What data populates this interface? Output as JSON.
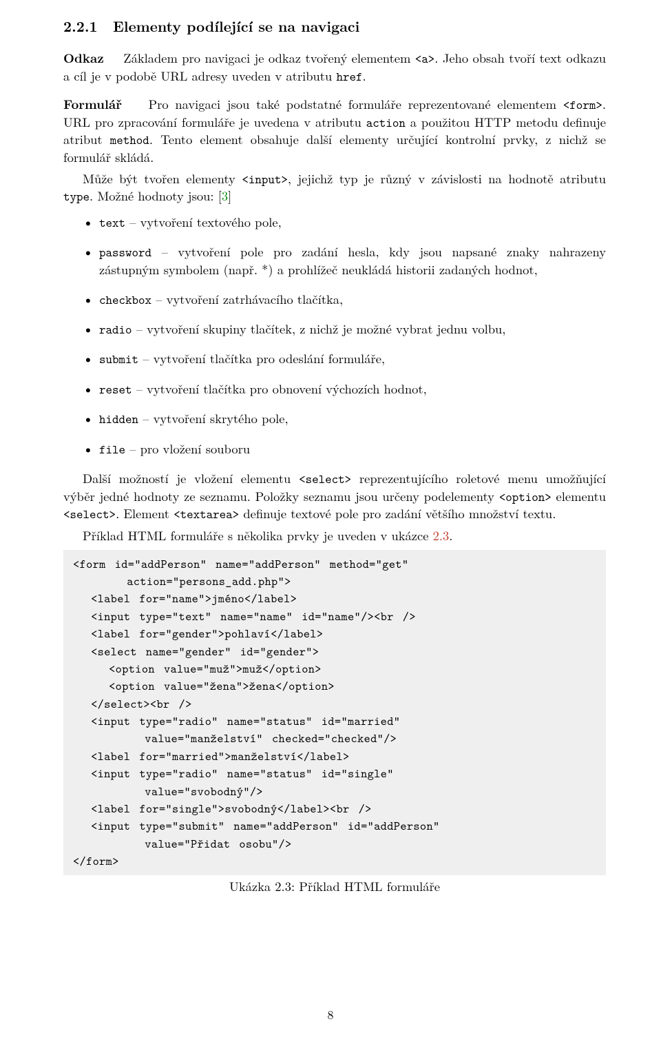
{
  "section": {
    "number": "2.2.1",
    "title": "Elementy podílející se na navigaci"
  },
  "odkaz": {
    "runin": "Odkaz",
    "text_a": "Základem pro navigaci je odkaz tvořený elementem ",
    "code_a": "<a>",
    "text_b": ". Jeho obsah tvoří text odkazu a cíl je v podobě URL adresy uveden v atributu ",
    "code_href": "href",
    "period": "."
  },
  "formular": {
    "runin": "Formulář",
    "p1a": "Pro navigaci jsou také podstatné formuláře reprezentované elementem ",
    "p1code": "<form>",
    "p1b": ". URL pro zpracování formuláře je uvedena v atributu ",
    "p1code2": "action",
    "p1c": " a použitou HTTP metodu definuje atribut ",
    "p1code3": "method",
    "p1d": ". Tento element obsahuje další elementy určující kontrolní prvky, z nichž se formulář skládá.",
    "p2a": "Může být tvořen elementy ",
    "p2code": "<input>",
    "p2b": ", jejichž typ je různý v závislosti na hodnotě atributu ",
    "p2code2": "type",
    "p2c": ". Možné hodnoty jsou: [",
    "cite3": "3",
    "p2d": "]"
  },
  "items": {
    "text": {
      "code": "text",
      "desc": " – vytvoření textového pole,"
    },
    "password": {
      "code": "password",
      "desc": " – vytvoření pole pro zadání hesla, kdy jsou napsané znaky nahrazeny zástupným symbolem (např. *) a prohlížeč neukládá historii zadaných hodnot,"
    },
    "checkbox": {
      "code": "checkbox",
      "desc": " – vytvoření zatrhávacího tlačítka,"
    },
    "radio": {
      "code": "radio",
      "desc": " – vytvoření skupiny tlačítek, z nichž je možné vybrat jednu volbu,"
    },
    "submit": {
      "code": "submit",
      "desc": " – vytvoření tlačítka pro odeslání formuláře,"
    },
    "reset": {
      "code": "reset",
      "desc": " – vytvoření tlačítka pro obnovení výchozích hodnot,"
    },
    "hidden": {
      "code": "hidden",
      "desc": " – vytvoření skrytého pole,"
    },
    "file": {
      "code": "file",
      "desc": " – pro vložení souboru"
    }
  },
  "after": {
    "p1a": "Další možností je vložení elementu ",
    "p1code1": "<select>",
    "p1b": " reprezentujícího roletové menu umožňující výběr jedné hodnoty ze seznamu. Položky seznamu jsou určeny podelementy ",
    "p1code2": "<option>",
    "p1c": " elementu ",
    "p1code3": "<select>",
    "p1d": ". Element ",
    "p1code4": "<textarea>",
    "p1e": " definuje textové pole pro zadání většího množství textu.",
    "p2a": "Příklad HTML formuláře s několika prvky je uveden v ukázce ",
    "ref": "2.3",
    "p2b": "."
  },
  "code": {
    "l1": "<form id=\"addPerson\" name=\"addPerson\" method=\"get\"",
    "l2": "      action=\"persons_add.php\">",
    "l3": "  <label for=\"name\">jméno</label>",
    "l4": "  <input type=\"text\" name=\"name\" id=\"name\"/><br />",
    "l5": "  <label for=\"gender\">pohlaví</label>",
    "l6": "  <select name=\"gender\" id=\"gender\">",
    "l7": "    <option value=\"muž\">muž</option>",
    "l8": "    <option value=\"žena\">žena</option>",
    "l9": "  </select><br />",
    "l10": "  <input type=\"radio\" name=\"status\" id=\"married\"",
    "l11": "        value=\"manželství\" checked=\"checked\"/>",
    "l12": "  <label for=\"married\">manželství</label>",
    "l13": "  <input type=\"radio\" name=\"status\" id=\"single\"",
    "l14": "        value=\"svobodný\"/>",
    "l15": "  <label for=\"single\">svobodný</label><br />",
    "l16": "  <input type=\"submit\" name=\"addPerson\" id=\"addPerson\"",
    "l17": "        value=\"Přidat osobu\"/>",
    "l18": "</form>"
  },
  "caption": {
    "label": "Ukázka 2.3: Příklad HTML formuláře"
  },
  "pagenum": "8"
}
